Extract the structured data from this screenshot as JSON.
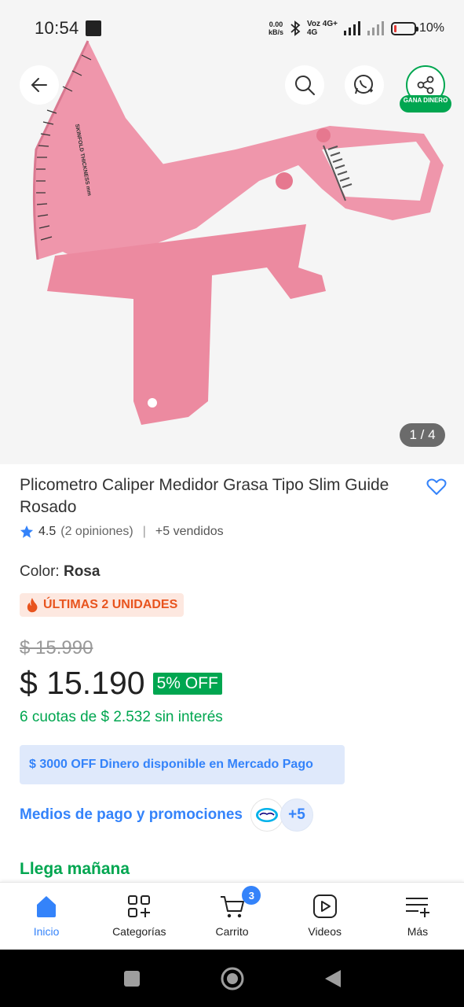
{
  "status_bar": {
    "time": "10:54",
    "speed_value": "0.00",
    "speed_unit": "kB/s",
    "network_top": "Voz 4G+",
    "network_bottom": "4G",
    "battery": "10%"
  },
  "gallery": {
    "counter": "1 / 4",
    "image_text": "SKINFOLD THICKNESS mm",
    "share_badge": "GANA DINERO"
  },
  "product": {
    "title": "Plicometro Caliper Medidor Grasa Tipo Slim Guide Rosado",
    "rating": "4.5",
    "reviews": "(2 opiniones)",
    "sold": "+5 vendidos",
    "color_label": "Color:",
    "color_value": "Rosa",
    "stock_badge": "ÚLTIMAS 2 UNIDADES",
    "old_price": "$ 15.990",
    "price": "$ 15.190",
    "discount": "5% OFF",
    "installments": "6 cuotas de $ 2.532 sin interés",
    "promo": "$ 3000 OFF Dinero disponible en Mercado Pago",
    "payment_link": "Medios de pago y promociones",
    "payment_more": "+5",
    "delivery": "Llega mañana"
  },
  "bottom_nav": {
    "items": [
      {
        "label": "Inicio",
        "icon": "home-icon",
        "active": true
      },
      {
        "label": "Categorías",
        "icon": "categories-icon"
      },
      {
        "label": "Carrito",
        "icon": "cart-icon",
        "badge": "3"
      },
      {
        "label": "Videos",
        "icon": "videos-icon"
      },
      {
        "label": "Más",
        "icon": "more-icon"
      }
    ]
  },
  "colors": {
    "accent_blue": "#3483fa",
    "green": "#00a650",
    "product_pink": "#ec8aa0",
    "stock_orange": "#e8541e"
  }
}
